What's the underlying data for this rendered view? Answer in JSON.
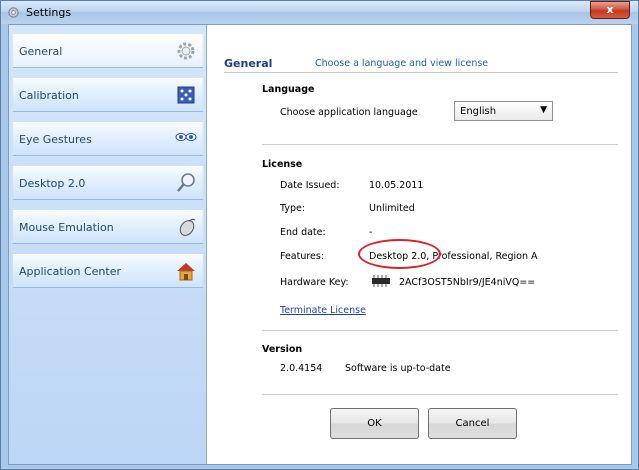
{
  "window": {
    "title": "Settings",
    "close_label": "x"
  },
  "sidebar": {
    "items": [
      {
        "label": "General",
        "icon": "gear-icon",
        "active": true
      },
      {
        "label": "Calibration",
        "icon": "calibration-grid-icon"
      },
      {
        "label": "Eye Gestures",
        "icon": "eyes-icon"
      },
      {
        "label": "Desktop 2.0",
        "icon": "magnifier-icon"
      },
      {
        "label": "Mouse Emulation",
        "icon": "mouse-icon"
      },
      {
        "label": "Application Center",
        "icon": "house-icon"
      }
    ]
  },
  "main": {
    "title": "General",
    "subtitle": "Choose a language and view license",
    "language": {
      "heading": "Language",
      "prompt": "Choose application language",
      "selected": "English"
    },
    "license": {
      "heading": "License",
      "date_issued_label": "Date Issued:",
      "date_issued_value": "10.05.2011",
      "type_label": "Type:",
      "type_value": "Unlimited",
      "end_date_label": "End date:",
      "end_date_value": "-",
      "features_label": "Features:",
      "features_value": "Desktop 2.0, Professional, Region A",
      "hardware_key_label": "Hardware Key:",
      "hardware_key_value": "2ACf3OST5NbIr9/JE4niVQ==",
      "terminate_link": "Terminate License"
    },
    "version": {
      "heading": "Version",
      "number": "2.0.4154",
      "status": "Software is up-to-date"
    },
    "buttons": {
      "ok": "OK",
      "cancel": "Cancel"
    }
  },
  "colors": {
    "title_blue": "#1f3c88",
    "link_blue": "#1c3fb8",
    "highlight_red": "#d9232c",
    "sidebar_bg": "#c7ddf8"
  }
}
